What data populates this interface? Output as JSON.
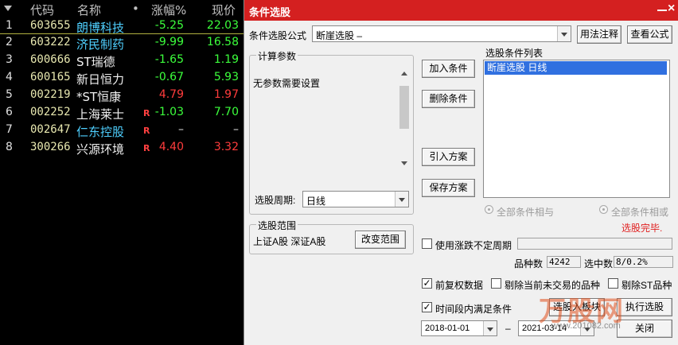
{
  "stock_list": {
    "headers": {
      "code": "代码",
      "name": "名称",
      "dot": "•",
      "change": "涨幅%",
      "price": "现价"
    },
    "rows": [
      {
        "idx": "1",
        "code": "603655",
        "name": "朗博科技",
        "flag": "",
        "change": "-5.25",
        "price": "22.03",
        "name_color": "#4fd0ff",
        "change_color": "#3cff3c",
        "price_color": "#3cff3c"
      },
      {
        "idx": "2",
        "code": "603222",
        "name": "济民制药",
        "flag": "",
        "change": "-9.99",
        "price": "16.58",
        "name_color": "#4fd0ff",
        "change_color": "#3cff3c",
        "price_color": "#3cff3c"
      },
      {
        "idx": "3",
        "code": "600666",
        "name": "ST瑞德",
        "flag": "",
        "change": "-1.65",
        "price": "1.19",
        "name_color": "#f0f0f0",
        "change_color": "#3cff3c",
        "price_color": "#3cff3c"
      },
      {
        "idx": "4",
        "code": "600165",
        "name": "新日恒力",
        "flag": "",
        "change": "-0.67",
        "price": "5.93",
        "name_color": "#f0f0f0",
        "change_color": "#3cff3c",
        "price_color": "#3cff3c"
      },
      {
        "idx": "5",
        "code": "002219",
        "name": "*ST恒康",
        "flag": "",
        "change": "4.79",
        "price": "1.97",
        "name_color": "#f0f0f0",
        "change_color": "#ff3c3c",
        "price_color": "#ff3c3c"
      },
      {
        "idx": "6",
        "code": "002252",
        "name": "上海莱士",
        "flag": "R",
        "change": "-1.03",
        "price": "7.70",
        "name_color": "#f0f0f0",
        "change_color": "#3cff3c",
        "price_color": "#3cff3c"
      },
      {
        "idx": "7",
        "code": "002647",
        "name": "仁东控股",
        "flag": "R",
        "change": "–",
        "price": "–",
        "name_color": "#4fd0ff",
        "change_color": "#e0e0e0",
        "price_color": "#e0e0e0"
      },
      {
        "idx": "8",
        "code": "300266",
        "name": "兴源环境",
        "flag": "R",
        "change": "4.40",
        "price": "3.32",
        "name_color": "#f0f0f0",
        "change_color": "#ff3c3c",
        "price_color": "#ff3c3c"
      }
    ]
  },
  "dialog": {
    "title": "条件选股",
    "formula_label": "条件选股公式",
    "formula_value": "断崖选股        –",
    "usage_btn": "用法注释",
    "view_formula_btn": "查看公式",
    "params_group": "计算参数",
    "params_text": "无参数需要设置",
    "period_label": "选股周期:",
    "period_value": "日线",
    "add_cond_btn": "加入条件",
    "del_cond_btn": "删除条件",
    "import_btn": "引入方案",
    "save_btn": "保存方案",
    "cond_list_label": "选股条件列表",
    "cond_item": "断崖选股  日线",
    "radio_and": "全部条件相与",
    "radio_or": "全部条件相或",
    "status": "选股完毕.",
    "range_group": "选股范围",
    "range_text": "上证A股 深证A股",
    "change_range_btn": "改变范围",
    "use_period_label": "使用涨跌不定周期",
    "count_label": "品种数",
    "count_value": "4242",
    "selected_label": "选中数",
    "selected_value": "8/0.2%",
    "pre_adjust_label": "前复权数据",
    "exclude_untraded_label": "剔除当前未交易的品种",
    "exclude_st_label": "剔除ST品种",
    "time_segment_label": "时间段内满足条件",
    "add_to_board_btn": "选股入板块",
    "run_btn": "执行选股",
    "date_from": "2018-01-01",
    "date_sep": "–",
    "date_to": "2021-03-14",
    "close_btn": "关闭",
    "watermark": "万股网",
    "watermark_url": "www.201082.com"
  },
  "colors": {
    "title_bar": "#d42020",
    "selected_item": "#3070e0",
    "status_text": "#e02020"
  }
}
